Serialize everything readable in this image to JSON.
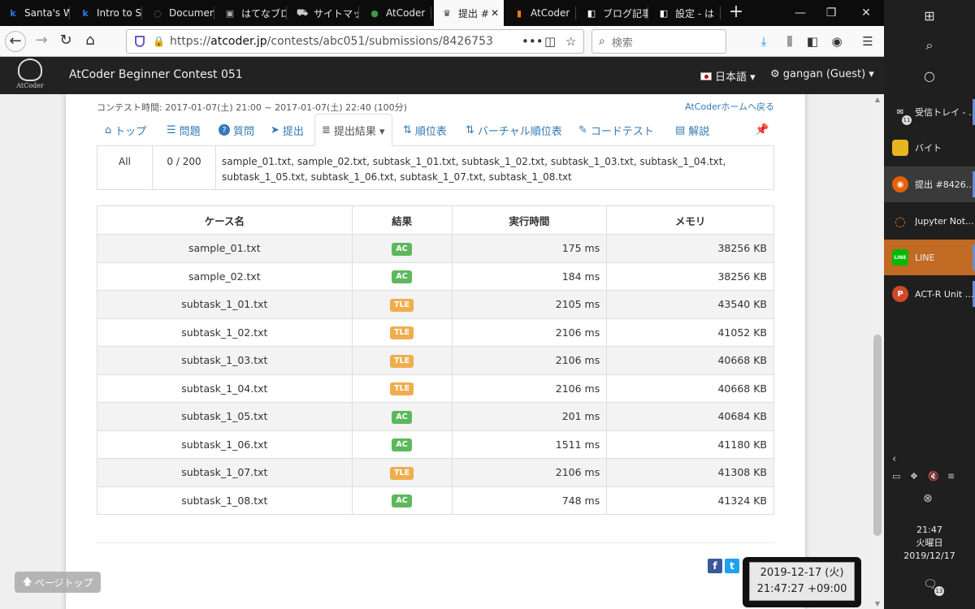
{
  "browser": {
    "tabs": [
      {
        "label": "Santa's W",
        "icon": "k",
        "icon_color": "#2b7de9"
      },
      {
        "label": "Intro to Sa",
        "icon": "k",
        "icon_color": "#2b7de9"
      },
      {
        "label": "Document",
        "icon": "◌",
        "icon_color": "#f37726"
      },
      {
        "label": "はてなブロ",
        "icon": "▣",
        "icon_color": "#888"
      },
      {
        "label": "サイトマップ",
        "icon": "⛟",
        "icon_color": "#555"
      },
      {
        "label": "AtCoder",
        "icon": "●",
        "icon_color": "#3c9a3c"
      },
      {
        "label": "提出 #",
        "icon": "♛",
        "icon_color": "#333"
      },
      {
        "label": "AtCoder",
        "icon": "▮",
        "icon_color": "#e87a1a"
      },
      {
        "label": "ブログ記事",
        "icon": "◧",
        "icon_color": "#fff"
      },
      {
        "label": "設定 - は",
        "icon": "◧",
        "icon_color": "#fff"
      }
    ],
    "url_prefix": "https://",
    "url_host": "atcoder.jp",
    "url_path": "/contests/abc051/submissions/8426753",
    "search_placeholder": "検索",
    "menu_dots": "•••"
  },
  "site": {
    "logo_text": "AtCoder",
    "contest_title": "AtCoder Beginner Contest 051",
    "language": "日本語 ▾",
    "user": "⚙ gangan (Guest) ▾"
  },
  "contest": {
    "duration": "コンテスト時間: 2017-01-07(土) 21:00 ~ 2017-01-07(土) 22:40 (100分)",
    "home_link": "AtCoderホームへ戻る"
  },
  "nav_tabs": [
    {
      "label": "トップ",
      "icon": "⌂"
    },
    {
      "label": "問題",
      "icon": "☰"
    },
    {
      "label": "質問",
      "icon": "?"
    },
    {
      "label": "提出",
      "icon": "➤"
    },
    {
      "label": "提出結果 ▾",
      "icon": "≣"
    },
    {
      "label": "順位表",
      "icon": "⇅"
    },
    {
      "label": "バーチャル順位表",
      "icon": "⇅"
    },
    {
      "label": "コードテスト",
      "icon": "✎"
    },
    {
      "label": "解説",
      "icon": "▤"
    }
  ],
  "summary": {
    "set_name": "All",
    "score": "0 / 200",
    "cases": "sample_01.txt, sample_02.txt, subtask_1_01.txt, subtask_1_02.txt, subtask_1_03.txt, subtask_1_04.txt, subtask_1_05.txt, subtask_1_06.txt, subtask_1_07.txt, subtask_1_08.txt"
  },
  "results": {
    "headers": [
      "ケース名",
      "結果",
      "実行時間",
      "メモリ"
    ],
    "rows": [
      {
        "name": "sample_01.txt",
        "status": "AC",
        "time": "175 ms",
        "memory": "38256 KB"
      },
      {
        "name": "sample_02.txt",
        "status": "AC",
        "time": "184 ms",
        "memory": "38256 KB"
      },
      {
        "name": "subtask_1_01.txt",
        "status": "TLE",
        "time": "2105 ms",
        "memory": "43540 KB"
      },
      {
        "name": "subtask_1_02.txt",
        "status": "TLE",
        "time": "2106 ms",
        "memory": "41052 KB"
      },
      {
        "name": "subtask_1_03.txt",
        "status": "TLE",
        "time": "2106 ms",
        "memory": "40668 KB"
      },
      {
        "name": "subtask_1_04.txt",
        "status": "TLE",
        "time": "2106 ms",
        "memory": "40668 KB"
      },
      {
        "name": "subtask_1_05.txt",
        "status": "AC",
        "time": "201 ms",
        "memory": "40684 KB"
      },
      {
        "name": "subtask_1_06.txt",
        "status": "AC",
        "time": "1511 ms",
        "memory": "41180 KB"
      },
      {
        "name": "subtask_1_07.txt",
        "status": "TLE",
        "time": "2106 ms",
        "memory": "41308 KB"
      },
      {
        "name": "subtask_1_08.txt",
        "status": "AC",
        "time": "748 ms",
        "memory": "41324 KB"
      }
    ]
  },
  "page_top": "ページトップ",
  "clock_widget": {
    "date": "2019-12-17 (火)",
    "time": "21:47:27 +09:00"
  },
  "taskbar": {
    "items": [
      {
        "label": "受信トレイ - ...",
        "icon": "✉",
        "color": "#1f1f1f",
        "badge": "11"
      },
      {
        "label": "バイト",
        "icon": "▮",
        "color": "#e8b520",
        "badge": ""
      },
      {
        "label": "提出 #8426...",
        "icon": "◉",
        "color": "#e66000",
        "badge": ""
      },
      {
        "label": "Jupyter Not...",
        "icon": "◌",
        "color": "#f37726",
        "badge": ""
      },
      {
        "label": "LINE",
        "icon": "LINE",
        "color": "#00b900",
        "badge": ""
      },
      {
        "label": "ACT-R Unit ...",
        "icon": "P",
        "color": "#d24726",
        "badge": ""
      }
    ],
    "time": "21:47",
    "weekday": "火曜日",
    "date": "2019/12/17",
    "notif_badge": "13"
  }
}
